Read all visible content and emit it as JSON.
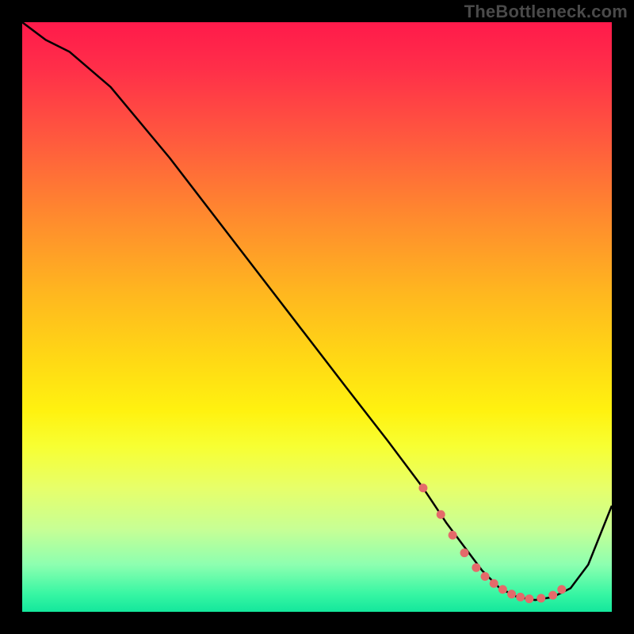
{
  "watermark": "TheBottleneck.com",
  "chart_data": {
    "type": "line",
    "title": "",
    "xlabel": "",
    "ylabel": "",
    "xlim": [
      0,
      100
    ],
    "ylim": [
      0,
      100
    ],
    "grid": false,
    "series": [
      {
        "name": "curve",
        "x": [
          0,
          4,
          8,
          15,
          25,
          35,
          45,
          55,
          62,
          68,
          72,
          75,
          78,
          81,
          84,
          87,
          90,
          93,
          96,
          100
        ],
        "y": [
          100,
          97,
          95,
          89,
          77,
          64,
          51,
          38,
          29,
          21,
          15,
          11,
          7,
          4,
          2.5,
          2,
          2.5,
          4,
          8,
          18
        ]
      }
    ],
    "markers": {
      "name": "highlight-dots",
      "color": "#e46a6a",
      "x": [
        68,
        71,
        73,
        75,
        77,
        78.5,
        80,
        81.5,
        83,
        84.5,
        86,
        88,
        90,
        91.5
      ],
      "y": [
        21,
        16.5,
        13,
        10,
        7.5,
        6,
        4.8,
        3.8,
        3,
        2.5,
        2.2,
        2.3,
        2.8,
        3.8
      ]
    }
  },
  "colors": {
    "line": "#000000",
    "marker": "#e46a6a",
    "background_top": "#ff1a4b",
    "background_bottom": "#14e79c"
  }
}
